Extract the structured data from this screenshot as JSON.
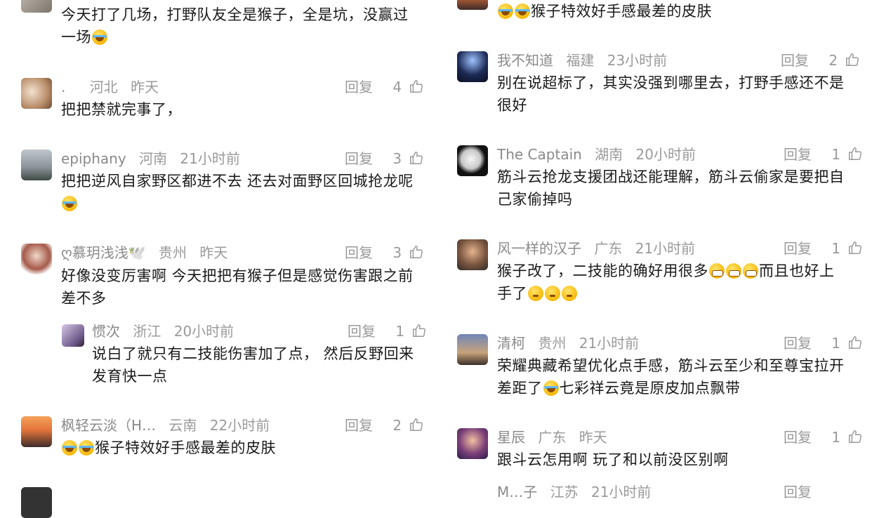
{
  "left": {
    "top_partial_text": "今天打了几场，打野队友全是猴子，全是坑，没赢过",
    "top_partial_text_line2": "一场",
    "comments": [
      {
        "user": ".",
        "location": "河北",
        "time": "昨天",
        "reply": "回复",
        "likes": "4",
        "text": "把把禁就完事了，"
      },
      {
        "user": "epiphany",
        "location": "河南",
        "time": "21小时前",
        "reply": "回复",
        "likes": "3",
        "text": "把把逆风自家野区都进不去 还去对面野区回城抢龙呢"
      },
      {
        "user": "ღ慕玥浅浅🕊️",
        "location": "贵州",
        "time": "昨天",
        "reply": "回复",
        "likes": "3",
        "text": "好像没变厉害啊 今天把把有猴子但是感觉伤害跟之前",
        "text2": "差不多"
      },
      {
        "user": "惯次",
        "location": "浙江",
        "time": "20小时前",
        "reply": "回复",
        "likes": "1",
        "text": "说白了就只有二技能伤害加了点， 然后反野回来",
        "text2": "发育快一点"
      },
      {
        "user": "枫轻云淡（H…",
        "location": "云南",
        "time": "22小时前",
        "reply": "回复",
        "likes": "2",
        "text": "猴子特效好手感最差的皮肤"
      }
    ]
  },
  "right": {
    "top_partial_text": "猴子特效好手感最差的皮肤",
    "comments": [
      {
        "user": "我不知道",
        "location": "福建",
        "time": "23小时前",
        "reply": "回复",
        "likes": "2",
        "text": "别在说超标了，其实没强到哪里去，打野手感还不是",
        "text2": "很好"
      },
      {
        "user": "The Captain",
        "location": "湖南",
        "time": "20小时前",
        "reply": "回复",
        "likes": "1",
        "text": "筋斗云抢龙支援团战还能理解，筋斗云偷家是要把自",
        "text2": "己家偷掉吗"
      },
      {
        "user": "风一样的汉子",
        "location": "广东",
        "time": "21小时前",
        "reply": "回复",
        "likes": "1",
        "text_a": "猴子改了，二技能的确好用很多",
        "text_b": "而且也好上",
        "text2": "手了"
      },
      {
        "user": "清柯",
        "location": "贵州",
        "time": "21小时前",
        "reply": "回复",
        "likes": "1",
        "text": "荣耀典藏希望优化点手感，筋斗云至少和至尊宝拉开",
        "text2_a": "差距了",
        "text2_b": "七彩祥云竟是原皮加点飘带"
      },
      {
        "user": "星辰",
        "location": "广东",
        "time": "昨天",
        "reply": "回复",
        "likes": "1",
        "text": "跟斗云怎用啊  玩了和以前没区别啊"
      }
    ],
    "bottom_partial": {
      "user": "M…子",
      "location": "江苏",
      "time": "21小时前",
      "reply": "回复"
    }
  },
  "icons": {
    "like": "thumbs-up-icon",
    "emoji_cry": "laugh-cry-emoji",
    "emoji_grin": "grin-emoji",
    "emoji_think": "thinking-emoji"
  },
  "colors": {
    "meta": "#9a9a9a",
    "text": "#1a1a1a",
    "background": "#ffffff"
  }
}
